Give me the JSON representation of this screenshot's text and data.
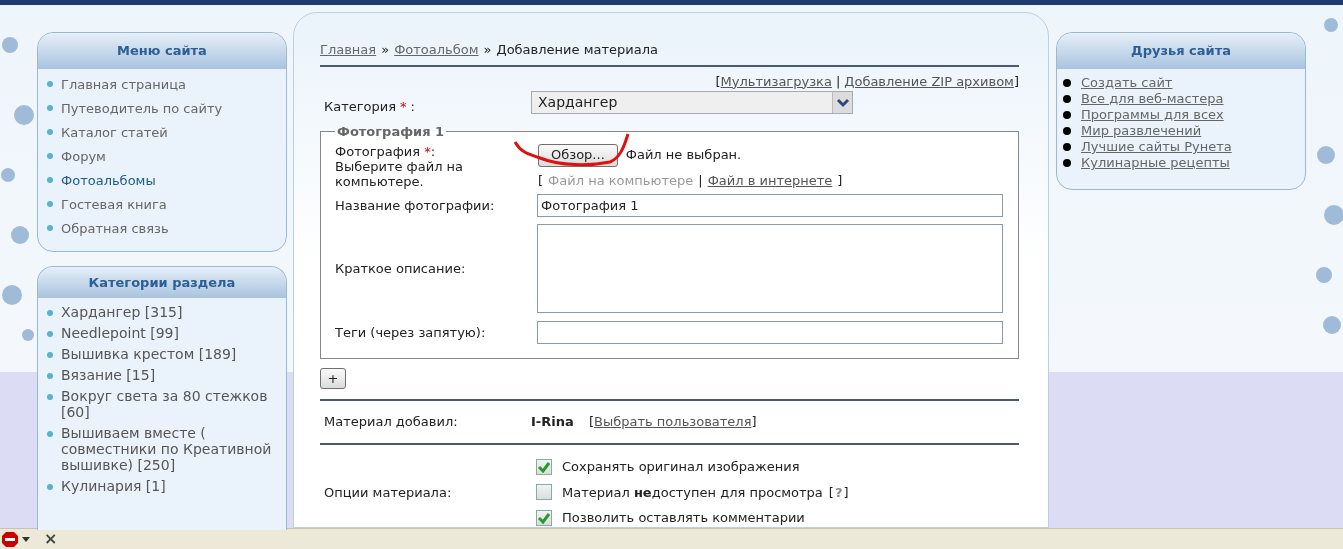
{
  "site_menu": {
    "title": "Меню сайта",
    "items": [
      {
        "label": "Главная страница",
        "selected": false
      },
      {
        "label": "Путеводитель по сайту",
        "selected": false
      },
      {
        "label": "Каталог статей",
        "selected": false
      },
      {
        "label": "Форум",
        "selected": false
      },
      {
        "label": "Фотоальбомы",
        "selected": true
      },
      {
        "label": "Гостевая книга",
        "selected": false
      },
      {
        "label": "Обратная связь",
        "selected": false
      }
    ]
  },
  "categories": {
    "title": "Категории раздела",
    "items": [
      "Хардангер [315]",
      "Needlepoint [99]",
      "Вышивка крестом [189]",
      "Вязание [15]",
      "Вокруг света за 80 стежков [60]",
      "Вышиваем вместе ( совместники по Креативной вышивке) [250]",
      "Кулинария [1]"
    ]
  },
  "breadcrumb": {
    "links": [
      "Главная",
      "Фотоальбом"
    ],
    "separator": "»",
    "current": "Добавление материала"
  },
  "upload_links": {
    "open": "[",
    "links": [
      "Мультизагрузка",
      "Добавление ZIP архивом"
    ],
    "separator": "|",
    "close": "]"
  },
  "category_field": {
    "label": "Категория",
    "required_mark": "*",
    "colon": ":",
    "value": "Хардангер"
  },
  "photo_fieldset": {
    "legend": "Фотография 1",
    "file_label": "Фотография",
    "required_mark": "*",
    "colon": ":",
    "file_hint": "Выберите файл на компьютере.",
    "browse_button": "Обзор...",
    "file_status": "Файл не выбран.",
    "sources_open": "[",
    "sources_separator": "|",
    "sources_close": "]",
    "sources": [
      {
        "label": "Файл на компьютере",
        "selected": true
      },
      {
        "label": "Файл в интернете",
        "selected": false
      }
    ],
    "name_label": "Название фотографии:",
    "name_value": "Фотография 1",
    "description_label": "Краткое описание:",
    "tags_label": "Теги (через запятую):"
  },
  "add_button": "+",
  "author": {
    "label": "Материал добавил:",
    "user": "I-Rina",
    "open": "[",
    "link": "Выбрать пользователя",
    "close": "]"
  },
  "options": {
    "label": "Опции материала:",
    "items": [
      {
        "label": "Сохранять оригинал изображения",
        "checked": true
      },
      {
        "label": "Материал **не**доступен для просмотра",
        "help_open": "[",
        "help": "?",
        "help_close": "]",
        "checked": false
      },
      {
        "label": "Позволить оставлять комментарии",
        "checked": true
      }
    ]
  },
  "friends": {
    "title": "Друзья сайта",
    "items": [
      "Создать сайт",
      "Все для веб-мастера",
      "Программы для всех",
      "Мир развлечений",
      "Лучшие сайты Рунета",
      "Кулинарные рецепты"
    ]
  },
  "addon_bar": {
    "close": "×"
  }
}
